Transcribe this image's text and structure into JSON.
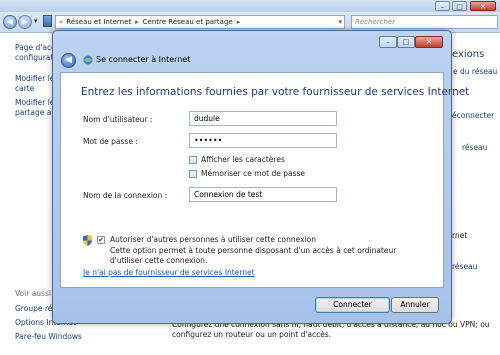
{
  "explorer": {
    "breadcrumb": [
      "Réseau et Internet",
      "Centre Réseau et partage"
    ],
    "search_placeholder": "Rechercher",
    "left_pane": {
      "links": [
        "Page d'accu",
        "configurati",
        "Modifier le",
        "carte",
        "Modifier le",
        "partage ava"
      ],
      "see_also_label": "Voir aussi",
      "see_also": [
        "Groupe rés",
        "Options Internet",
        "Pare-feu Windows"
      ]
    },
    "right_pane": {
      "title": "exions",
      "items": [
        "e du réseau",
        "éconnecter",
        "réseau",
        "rnet",
        "réseau"
      ]
    },
    "bottom_text": "Configurez une connexion sans fil, haut débit, d'accès à distance, ad hoc ou VPN; ou configurez un routeur ou un point d'accès."
  },
  "dialog": {
    "title": "Se connecter à Internet",
    "heading": "Entrez les informations fournies par votre fournisseur de services Internet",
    "username_label": "Nom d'utilisateur :",
    "username_value": "dudule",
    "password_label": "Mot de passe :",
    "password_value": "••••••",
    "show_chars_label": "Afficher les caractères",
    "remember_label": "Mémoriser ce mot de passe",
    "connection_name_label": "Nom de la connexion :",
    "connection_name_value": "Connexion de test",
    "share_label": "Autoriser d'autres personnes à utiliser cette connexion",
    "share_desc": "Cette option permet à toute personne disposant d'un accès à cet ordinateur d'utiliser cette connexion.",
    "no_isp_link": "Je n'ai pas de fournisseur de services Internet",
    "connect_button": "Connecter",
    "cancel_button": "Annuler",
    "show_chars_checked": false,
    "remember_checked": false,
    "share_checked": true
  }
}
